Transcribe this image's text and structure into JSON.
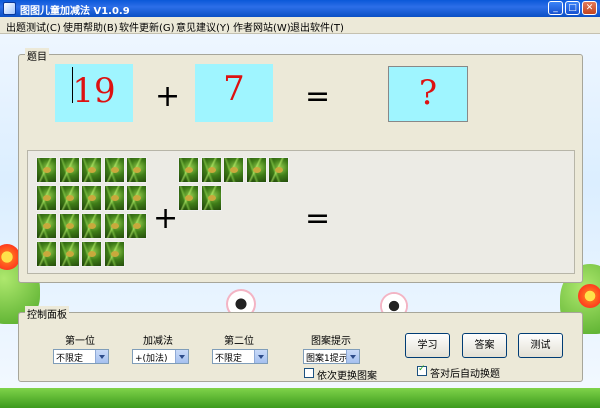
{
  "window": {
    "title": "图图儿童加减法 V1.0.9"
  },
  "menu": [
    "出题测试(C)",
    "使用帮助(B)",
    "软件更新(G)",
    "意见建议(Y)",
    "作者网站(W)",
    "退出软件(T)"
  ],
  "question": {
    "label": "题目",
    "first": "19",
    "operator": "+",
    "second": "7",
    "equals": "=",
    "answer": "?"
  },
  "pictures": {
    "operator": "+",
    "equals": "=",
    "first_count": 19,
    "second_count": 7
  },
  "control": {
    "label": "控制面板",
    "first_label": "第一位",
    "first_value": "不限定",
    "op_label": "加减法",
    "op_value": "+(加法)",
    "second_label": "第二位",
    "second_value": "不限定",
    "hint_label": "图案提示",
    "hint_value": "图案1提示",
    "change_pattern_label": "依次更换图案",
    "learn_button": "学习",
    "answer_button": "答案",
    "test_button": "测试",
    "auto_next_label": "答对后自动换题"
  },
  "colors": {
    "number_box": "#9ff5ff",
    "number_text": "#dd1111",
    "titlebar": "#0a58d8"
  }
}
